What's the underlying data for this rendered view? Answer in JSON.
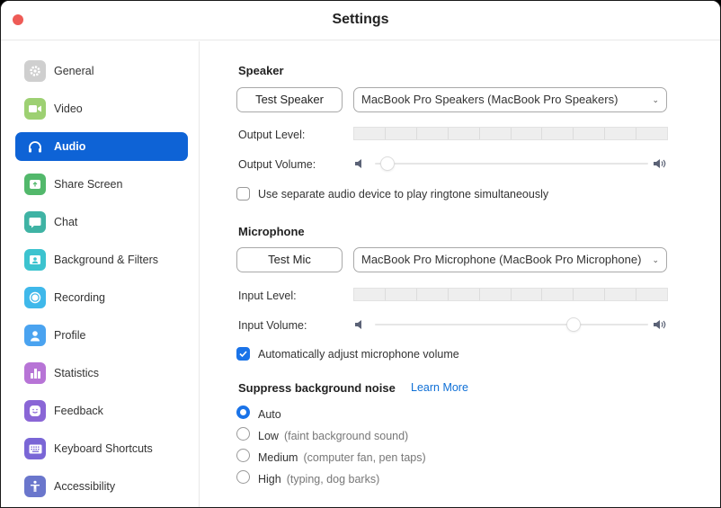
{
  "window": {
    "title": "Settings"
  },
  "sidebar": {
    "items": [
      {
        "label": "General",
        "icon": "gear-icon",
        "color": "#cfcfcf",
        "active": false
      },
      {
        "label": "Video",
        "icon": "video-camera-icon",
        "color": "#9dd072",
        "active": false
      },
      {
        "label": "Audio",
        "icon": "headphones-icon",
        "color": "#0e63d6",
        "active": true
      },
      {
        "label": "Share Screen",
        "icon": "share-screen-icon",
        "color": "#52b86b",
        "active": false
      },
      {
        "label": "Chat",
        "icon": "chat-bubble-icon",
        "color": "#3fb3a4",
        "active": false
      },
      {
        "label": "Background & Filters",
        "icon": "background-person-icon",
        "color": "#3cc3cf",
        "active": false
      },
      {
        "label": "Recording",
        "icon": "record-icon",
        "color": "#3fb8ea",
        "active": false
      },
      {
        "label": "Profile",
        "icon": "person-icon",
        "color": "#4aa3f0",
        "active": false
      },
      {
        "label": "Statistics",
        "icon": "bar-chart-icon",
        "color": "#b774d6",
        "active": false
      },
      {
        "label": "Feedback",
        "icon": "smiley-icon",
        "color": "#8a66d6",
        "active": false
      },
      {
        "label": "Keyboard Shortcuts",
        "icon": "keyboard-icon",
        "color": "#7a66d6",
        "active": false
      },
      {
        "label": "Accessibility",
        "icon": "accessibility-icon",
        "color": "#6a76cc",
        "active": false
      }
    ]
  },
  "speaker": {
    "title": "Speaker",
    "test_button": "Test Speaker",
    "device": "MacBook Pro Speakers (MacBook Pro Speakers)",
    "output_level_label": "Output Level:",
    "output_level_segments": 10,
    "output_level_lit": 0,
    "output_volume_label": "Output Volume:",
    "output_volume": 0.02,
    "separate_device_label": "Use separate audio device to play ringtone simultaneously",
    "separate_device_checked": false
  },
  "microphone": {
    "title": "Microphone",
    "test_button": "Test Mic",
    "device": "MacBook Pro Microphone (MacBook Pro Microphone)",
    "input_level_label": "Input Level:",
    "input_level_segments": 10,
    "input_level_lit": 0,
    "input_volume_label": "Input Volume:",
    "input_volume": 0.74,
    "auto_adjust_label": "Automatically adjust microphone volume",
    "auto_adjust_checked": true
  },
  "noise": {
    "title": "Suppress background noise",
    "learn_more": "Learn More",
    "options": [
      {
        "label": "Auto",
        "desc": "",
        "checked": true
      },
      {
        "label": "Low",
        "desc": "(faint background sound)",
        "checked": false
      },
      {
        "label": "Medium",
        "desc": "(computer fan, pen taps)",
        "checked": false
      },
      {
        "label": "High",
        "desc": "(typing, dog barks)",
        "checked": false
      }
    ]
  },
  "colors": {
    "accent": "#0e63d6",
    "checkbox_blue": "#1a73e8",
    "link": "#0e6fd6",
    "close": "#ee5b56"
  }
}
